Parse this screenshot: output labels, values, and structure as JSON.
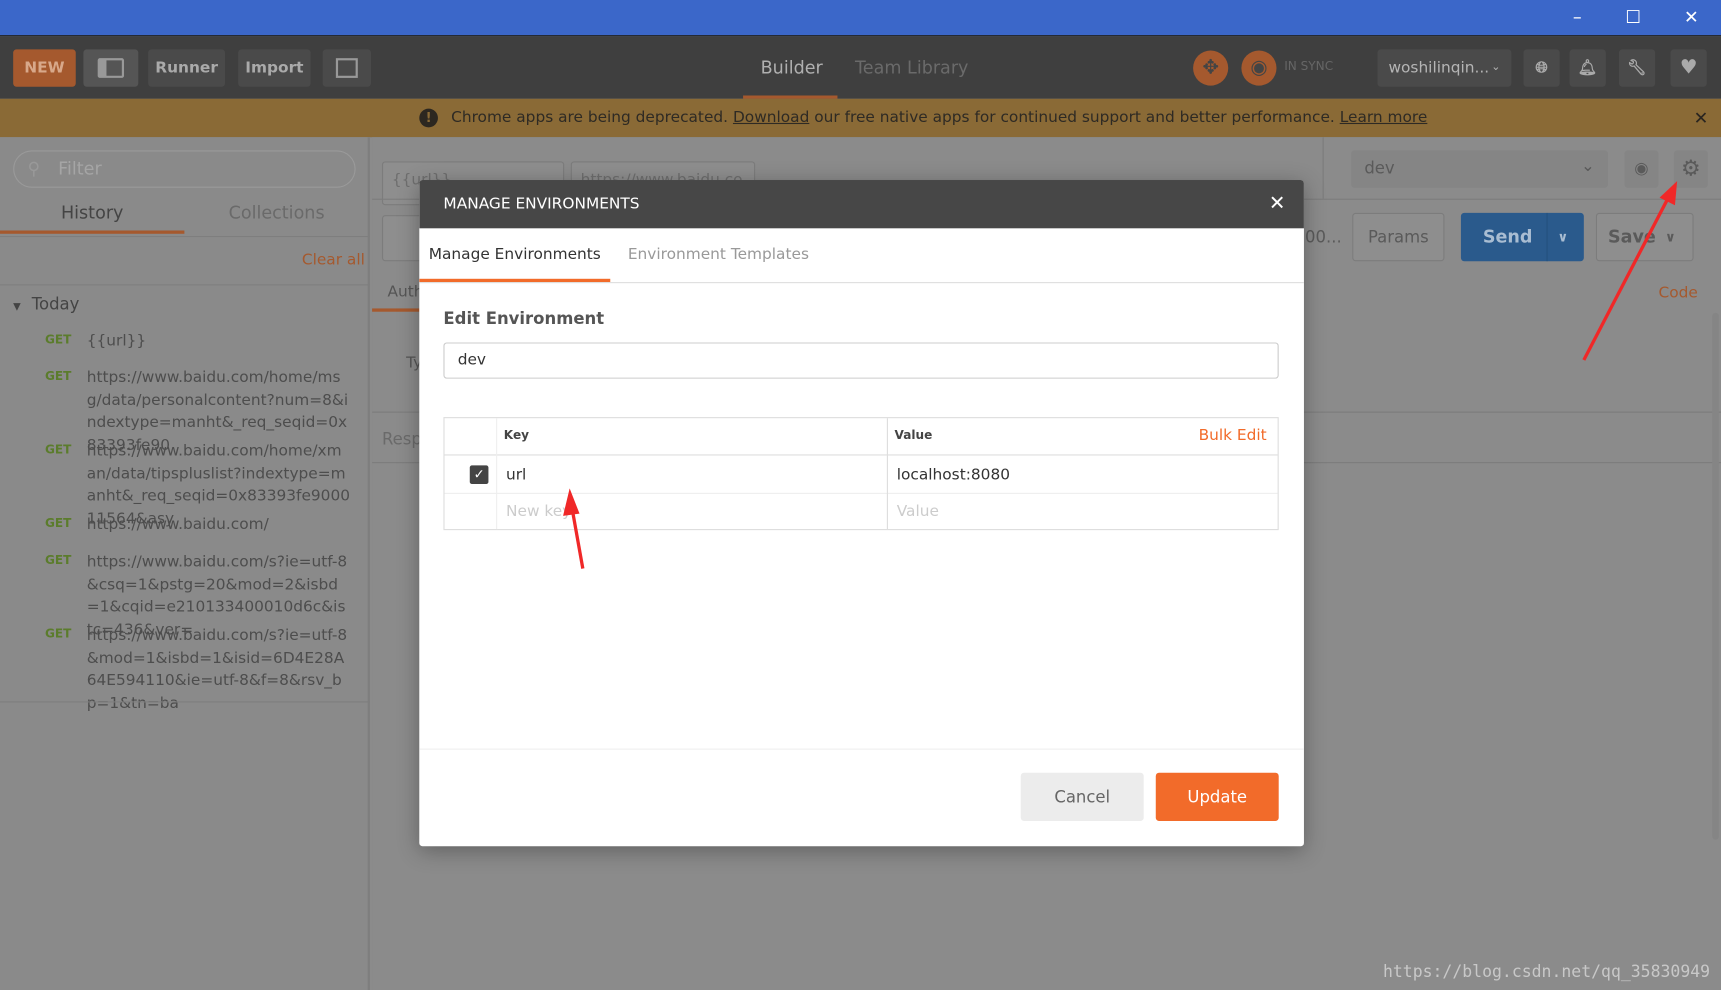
{
  "window": {
    "minimize": "–",
    "maximize": "☐",
    "close": "✕"
  },
  "toolbar": {
    "new_label": "NEW",
    "runner_label": "Runner",
    "import_label": "Import",
    "tabs": [
      "Builder",
      "Team Library"
    ],
    "sync_label": "IN SYNC",
    "user": "woshilinqin...",
    "brand_color": "#f26b2a"
  },
  "banner": {
    "text_before": "Chrome apps are being deprecated.",
    "download": "Download",
    "text_middle": "our free native apps for continued support and better performance.",
    "learn_more": "Learn more"
  },
  "sidebar": {
    "filter_placeholder": "Filter",
    "tabs": [
      "History",
      "Collections"
    ],
    "clear_all": "Clear all",
    "group": "Today",
    "items": [
      {
        "method": "GET",
        "url": "{{url}}"
      },
      {
        "method": "GET",
        "url": "https://www.baidu.com/home/msg/data/personalcontent?num=8&indextype=manht&_req_seqid=0x83393fe90"
      },
      {
        "method": "GET",
        "url": "https://www.baidu.com/home/xman/data/tipspluslist?indextype=manht&_req_seqid=0x83393fe900011564&asy"
      },
      {
        "method": "GET",
        "url": "https://www.baidu.com/"
      },
      {
        "method": "GET",
        "url": "https://www.baidu.com/s?ie=utf-8&csq=1&pstg=20&mod=2&isbd=1&cqid=e210133400010d6c&istc=436&ver="
      },
      {
        "method": "GET",
        "url": "https://www.baidu.com/s?ie=utf-8&mod=1&isbd=1&isid=6D4E28A64E594110&ie=utf-8&f=8&rsv_bp=1&tn=ba"
      }
    ]
  },
  "main": {
    "request_tabs": [
      "{{url}}",
      "https://www.baidu.co"
    ],
    "environment": "dev",
    "params": "Params",
    "send": "Send",
    "save": "Save",
    "code": "Code",
    "auth_tab": "Auth",
    "type_label": "Ty",
    "response_label": "Resp",
    "truncated": "00..."
  },
  "modal": {
    "title": "MANAGE ENVIRONMENTS",
    "tabs": [
      "Manage Environments",
      "Environment Templates"
    ],
    "section": "Edit Environment",
    "env_name": "dev",
    "table": {
      "key_header": "Key",
      "value_header": "Value",
      "bulk_edit": "Bulk Edit",
      "rows": [
        {
          "enabled": true,
          "key": "url",
          "value": "localhost:8080"
        }
      ],
      "new_key_placeholder": "New key",
      "value_placeholder": "Value"
    },
    "cancel": "Cancel",
    "update": "Update"
  },
  "watermark": "https://blog.csdn.net/qq_35830949"
}
